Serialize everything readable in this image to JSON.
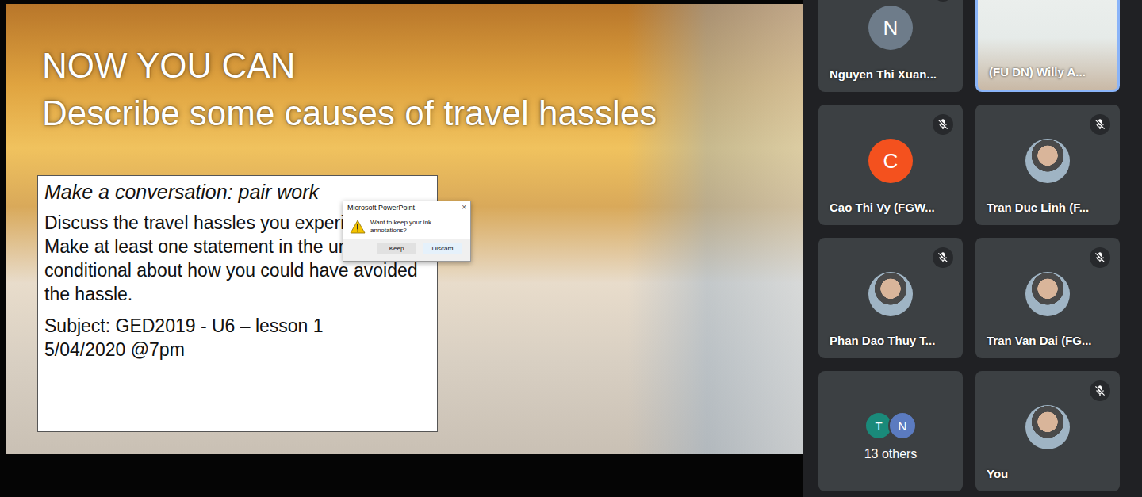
{
  "slide": {
    "title_lines": [
      "NOW YOU CAN",
      "Describe some causes of travel hassles"
    ],
    "task": {
      "heading": "Make a conversation: pair work",
      "body": "Discuss the travel hassles you experienced. Make at least one statement in the unreal conditional about how you could have avoided the hassle.",
      "subject": "Subject: GED2019 - U6 – lesson 1",
      "date": "5/04/2020 @7pm"
    }
  },
  "dialog": {
    "title": "Microsoft PowerPoint",
    "close": "×",
    "message": "Want to keep your ink annotations?",
    "buttons": [
      {
        "label": "Keep",
        "selected": false
      },
      {
        "label": "Discard",
        "selected": true
      }
    ]
  },
  "tiles": [
    {
      "kind": "letter",
      "name": "Nguyen Thi Xuan...",
      "letter": "N",
      "color": "#6e7c8a",
      "muted": true,
      "speaking": false
    },
    {
      "kind": "video",
      "name": "(FU DN) Willy A...",
      "muted": false,
      "speaking": true
    },
    {
      "kind": "letter",
      "name": "Cao Thi Vy (FGW...",
      "letter": "C",
      "color": "#f4511e",
      "muted": true,
      "speaking": false
    },
    {
      "kind": "photo",
      "name": "Tran Duc Linh (F...",
      "muted": true,
      "speaking": false
    },
    {
      "kind": "photo",
      "name": "Phan Dao Thuy T...",
      "muted": true,
      "speaking": false
    },
    {
      "kind": "photo",
      "name": "Tran Van Dai (FG...",
      "muted": true,
      "speaking": false
    },
    {
      "kind": "others",
      "name": "13 others",
      "avatars": [
        {
          "letter": "T",
          "color": "#1a8a7a"
        },
        {
          "letter": "N",
          "color": "#5b7bc0"
        }
      ],
      "muted": false,
      "speaking": false
    },
    {
      "kind": "photo",
      "name": "You",
      "muted": true,
      "speaking": false
    }
  ]
}
